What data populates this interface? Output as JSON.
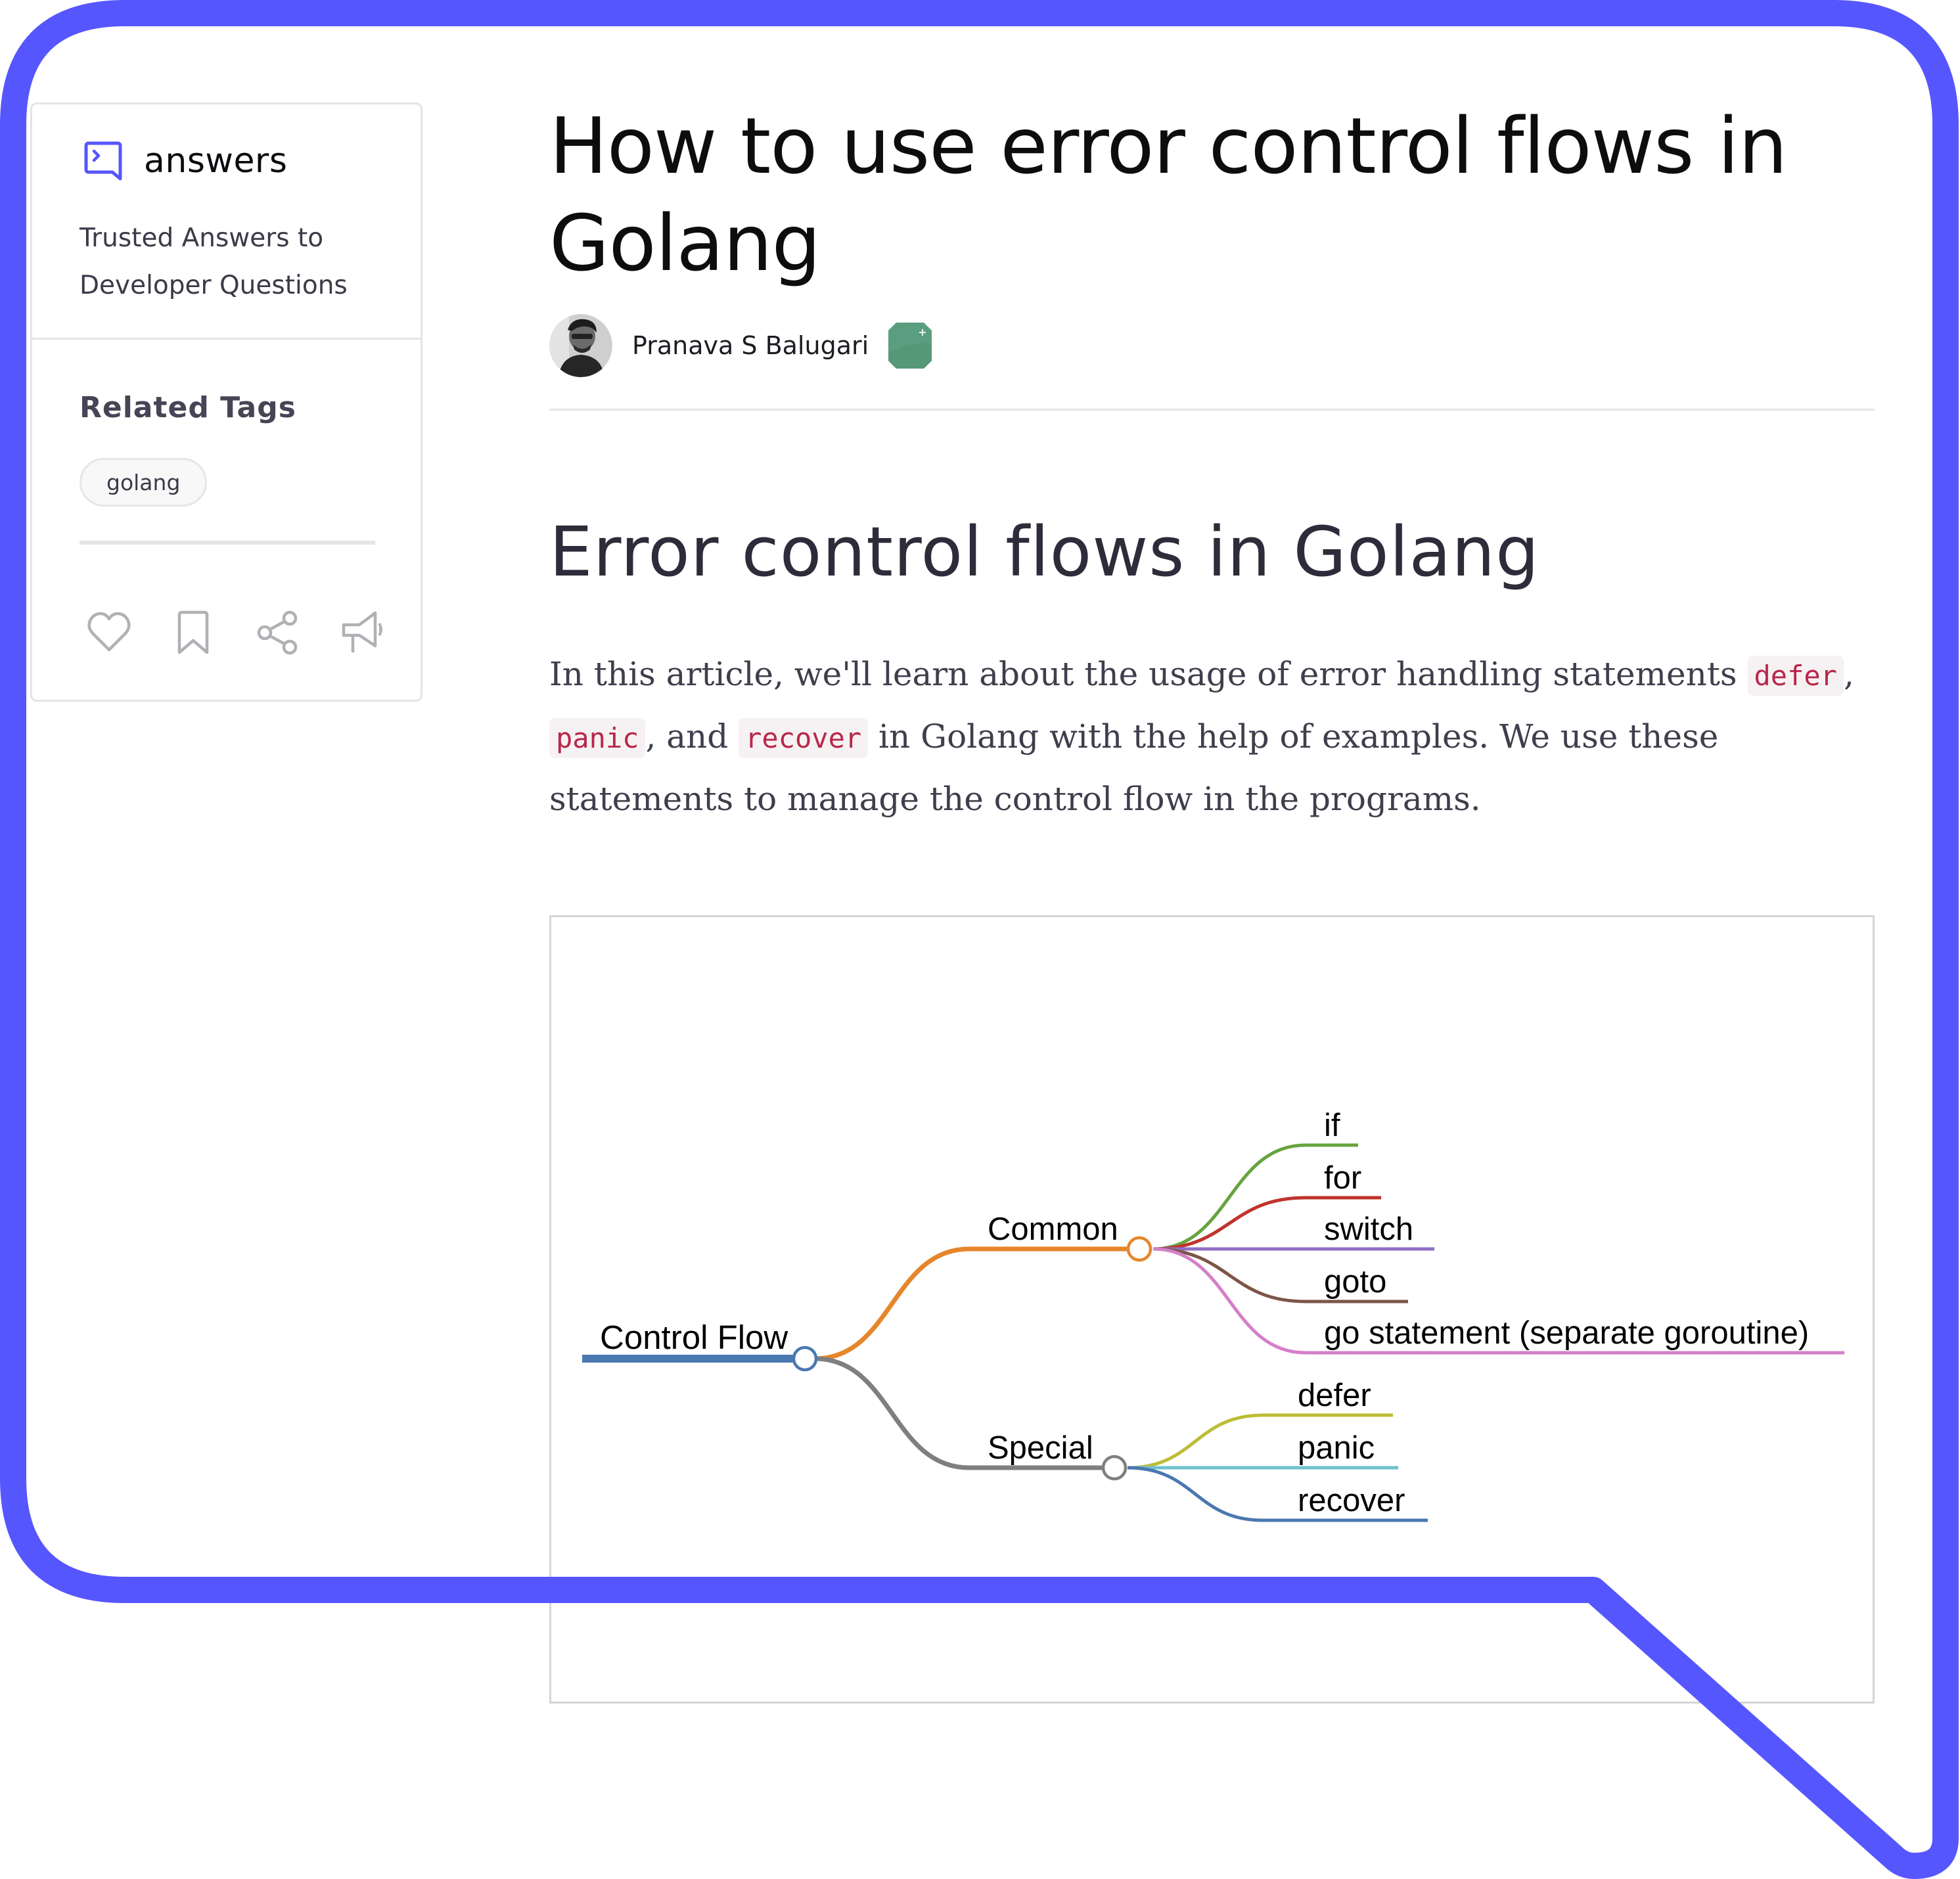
{
  "brand": {
    "logo_icon": "answers-logo-icon",
    "name": "answers",
    "tagline": "Trusted Answers to Developer Questions",
    "accent_color": "#5656ff"
  },
  "sidebar": {
    "related_tags_title": "Related Tags",
    "tags": [
      "golang"
    ],
    "actions": [
      {
        "icon": "heart-icon",
        "label": "Like"
      },
      {
        "icon": "bookmark-icon",
        "label": "Bookmark"
      },
      {
        "icon": "share-icon",
        "label": "Share"
      },
      {
        "icon": "megaphone-icon",
        "label": "Announce"
      }
    ]
  },
  "article": {
    "title": "How to use error control flows in Golang",
    "author": {
      "name": "Pranava S Balugari",
      "avatar_icon": "avatar",
      "badge_icon": "gem-badge-icon",
      "badge_color": "#5a9e80"
    },
    "section_heading": "Error control flows in Golang",
    "intro": {
      "t1": "In this article, we'll learn about the usage of error handling statements ",
      "c1": "defer",
      "t2": ", ",
      "c2": "panic",
      "t3": ", and ",
      "c3": "recover",
      "t4": " in Golang with the help of examples. We use these statements to manage the control flow in the programs."
    }
  },
  "diagram": {
    "type": "mindmap",
    "root": {
      "label": "Control Flow",
      "color": "#4a78b0"
    },
    "branches": [
      {
        "label": "Common",
        "color": "#e6862b",
        "children": [
          {
            "label": "if",
            "color": "#67a33f"
          },
          {
            "label": "for",
            "color": "#c0332c"
          },
          {
            "label": "switch",
            "color": "#8f6fc4"
          },
          {
            "label": "goto",
            "color": "#7c5647"
          },
          {
            "label": "go statement (separate goroutine)",
            "color": "#d57fc8"
          }
        ]
      },
      {
        "label": "Special",
        "color": "#7f7f7f",
        "children": [
          {
            "label": "defer",
            "color": "#bcbd36"
          },
          {
            "label": "panic",
            "color": "#6ec2cf"
          },
          {
            "label": "recover",
            "color": "#4a78b0"
          }
        ]
      }
    ]
  }
}
